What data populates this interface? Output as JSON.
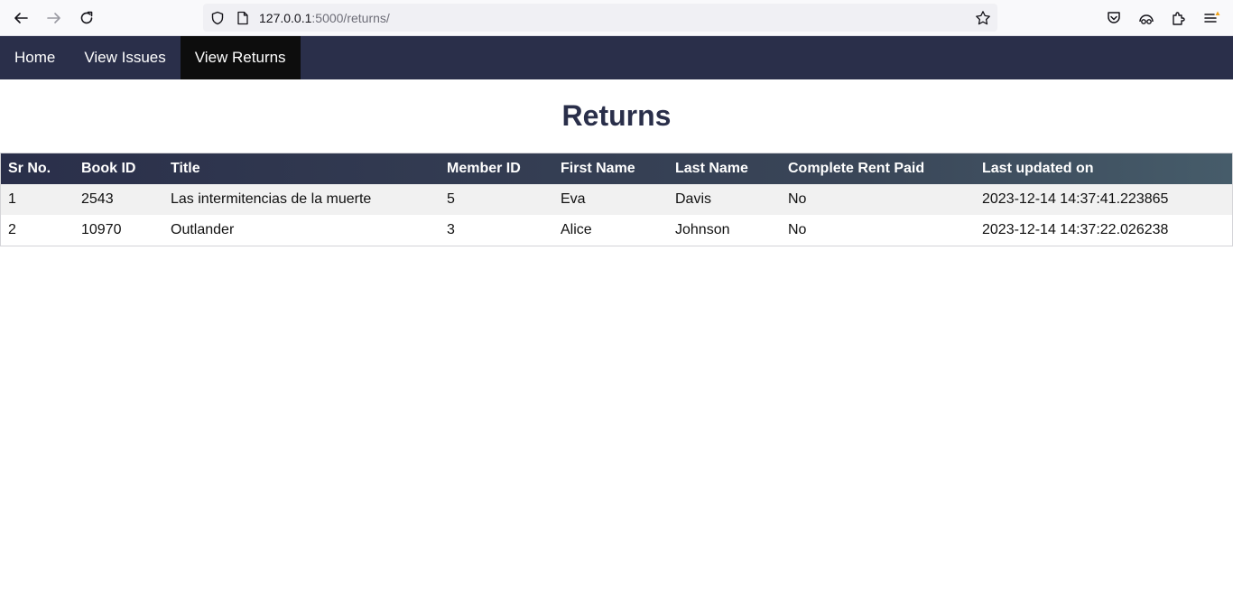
{
  "browser": {
    "url_host": "127.0.0.1",
    "url_path": ":5000/returns/"
  },
  "nav": {
    "items": [
      {
        "label": "Home"
      },
      {
        "label": "View Issues"
      },
      {
        "label": "View Returns",
        "active": true
      }
    ]
  },
  "page": {
    "title": "Returns"
  },
  "table": {
    "headers": [
      "Sr No.",
      "Book ID",
      "Title",
      "Member ID",
      "First Name",
      "Last Name",
      "Complete Rent Paid",
      "Last updated on"
    ],
    "rows": [
      [
        "1",
        "2543",
        "Las intermitencias de la muerte",
        "5",
        "Eva",
        "Davis",
        "No",
        "2023-12-14 14:37:41.223865"
      ],
      [
        "2",
        "10970",
        "Outlander",
        "3",
        "Alice",
        "Johnson",
        "No",
        "2023-12-14 14:37:22.026238"
      ]
    ]
  },
  "colors": {
    "nav_bg": "#2a2f4a",
    "nav_active_bg": "#0d0d0d",
    "title_color": "#2a2f4a",
    "row_alt_bg": "#f1f1f1"
  }
}
